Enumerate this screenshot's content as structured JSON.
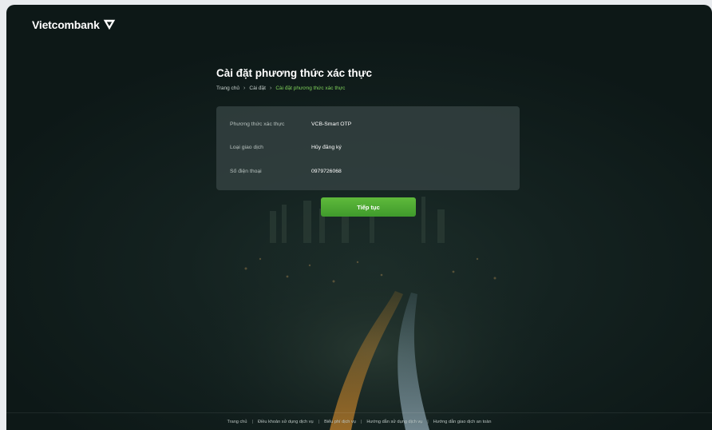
{
  "brand": {
    "name": "Vietcombank"
  },
  "page": {
    "title": "Cài đặt phương thức xác thực"
  },
  "breadcrumb": [
    "Trang chủ",
    "Cài đặt",
    "Cài đặt phương thức xác thực"
  ],
  "details": [
    {
      "label": "Phương thức xác thực",
      "value": "VCB-Smart OTP"
    },
    {
      "label": "Loại giao dịch",
      "value": "Hủy đăng ký"
    },
    {
      "label": "Số điện thoại",
      "value": "0979726068"
    }
  ],
  "actions": {
    "continue_label": "Tiếp tục"
  },
  "footer": {
    "links": [
      "Trang chủ",
      "Điều khoản sử dụng dịch vụ",
      "Biểu phí dịch vụ",
      "Hướng dẫn sử dụng dịch vụ",
      "Hướng dẫn giao dịch an toàn"
    ]
  },
  "colors": {
    "accent": "#4caf36",
    "breadcrumb_active": "#7fd25a",
    "background": "#142220"
  },
  "icons": {
    "brand_mark": "vietcombank-logo-icon",
    "breadcrumb_separator": "chevron-right-icon",
    "background": "night-highway-city-image"
  }
}
